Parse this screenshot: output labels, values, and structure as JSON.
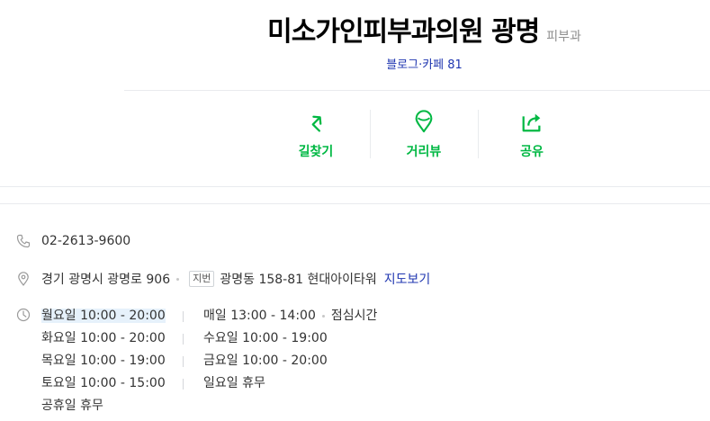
{
  "header": {
    "place_name": "미소가인피부과의원 광명",
    "category": "피부과",
    "reviews": "블로그·카페 81"
  },
  "actions": [
    {
      "label": "길찾기",
      "icon": "directions-icon"
    },
    {
      "label": "거리뷰",
      "icon": "street-view-icon"
    },
    {
      "label": "공유",
      "icon": "share-icon"
    }
  ],
  "info": {
    "phone": "02-2613-9600",
    "road_address": "경기 광명시 광명로 906",
    "lot_badge": "지번",
    "lot_address": "광명동 158-81 현대아이타워",
    "map_link": "지도보기"
  },
  "hours": {
    "left": [
      "월요일 10:00 - 20:00",
      "화요일 10:00 - 20:00",
      "목요일 10:00 - 19:00",
      "토요일 10:00 - 15:00",
      "공휴일 휴무"
    ],
    "right": [
      "매일 13:00 - 14:00",
      "수요일 10:00 - 19:00",
      "금요일 10:00 - 20:00",
      "일요일 휴무"
    ],
    "break_label": "점심시간"
  },
  "colors": {
    "accent_green": "#00b843",
    "link_blue": "#1f36b0",
    "highlight": "#e6f1fb"
  }
}
